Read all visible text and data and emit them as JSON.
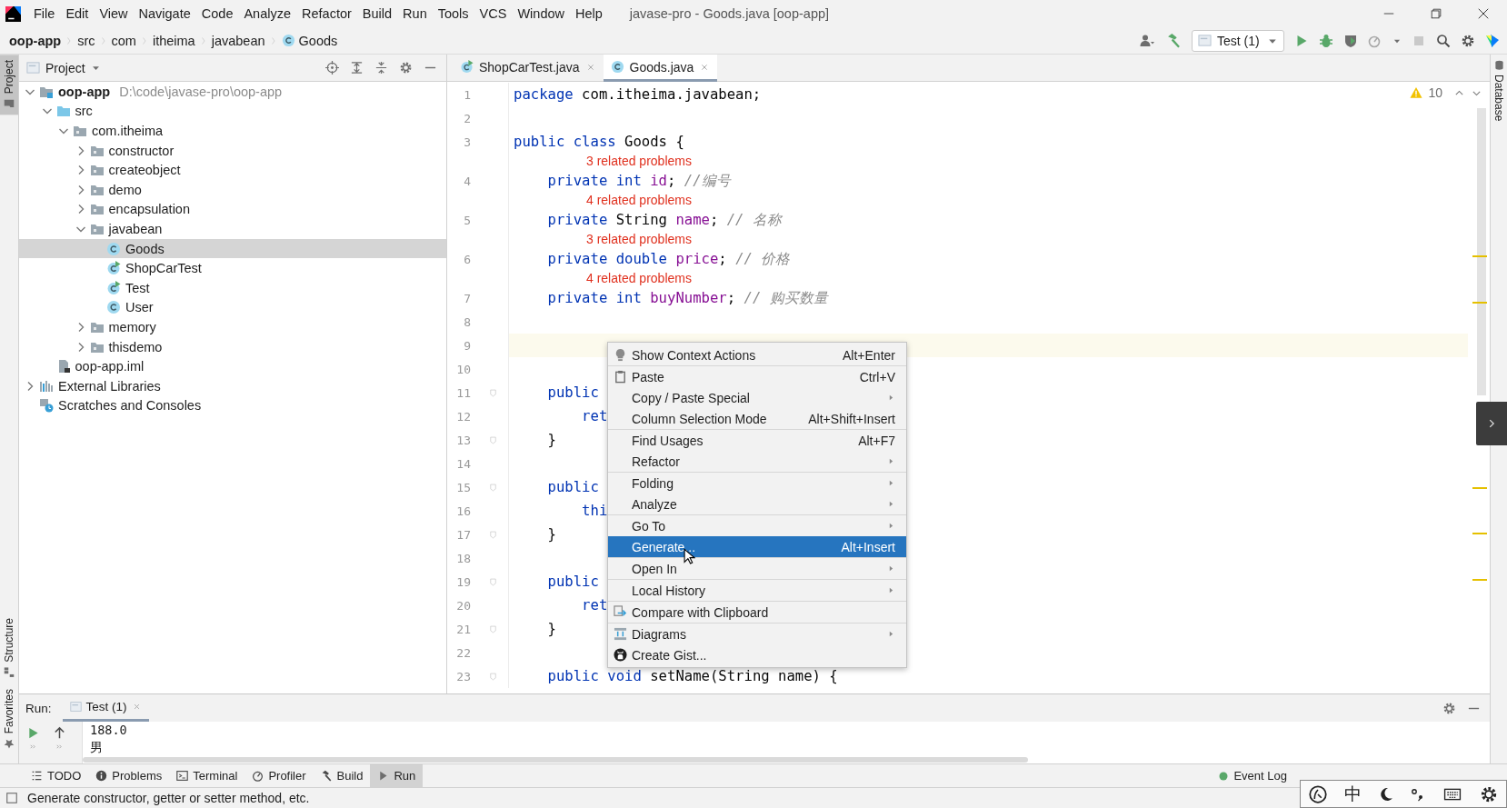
{
  "window": {
    "title": "javase-pro - Goods.java [oop-app]"
  },
  "menu": [
    "File",
    "Edit",
    "View",
    "Navigate",
    "Code",
    "Analyze",
    "Refactor",
    "Build",
    "Run",
    "Tools",
    "VCS",
    "Window",
    "Help"
  ],
  "breadcrumbs": [
    {
      "label": "oop-app",
      "kind": "module"
    },
    {
      "label": "src",
      "kind": "folder"
    },
    {
      "label": "com",
      "kind": "folder"
    },
    {
      "label": "itheima",
      "kind": "folder"
    },
    {
      "label": "javabean",
      "kind": "folder"
    },
    {
      "label": "Goods",
      "kind": "class"
    }
  ],
  "run_config": {
    "label": "Test (1)"
  },
  "left_strip": {
    "top": [
      {
        "label": "Project",
        "kind": "project",
        "selected": true
      }
    ],
    "bottom": [
      {
        "label": "Structure",
        "kind": "structure",
        "selected": false
      },
      {
        "label": "Favorites",
        "kind": "favorites",
        "selected": false
      }
    ]
  },
  "right_strip": [
    {
      "label": "Database",
      "kind": "database"
    }
  ],
  "project": {
    "title": "Project",
    "tree": [
      {
        "label": "oop-app",
        "kind": "module",
        "path": "D:\\code\\javase-pro\\oop-app",
        "expanded": true,
        "selected": false,
        "children": [
          {
            "label": "src",
            "kind": "source-folder",
            "expanded": true,
            "selected": false,
            "children": [
              {
                "label": "com.itheima",
                "kind": "package",
                "expanded": true,
                "selected": false,
                "children": [
                  {
                    "label": "constructor",
                    "kind": "package",
                    "expanded": false,
                    "selected": false
                  },
                  {
                    "label": "createobject",
                    "kind": "package",
                    "expanded": false,
                    "selected": false
                  },
                  {
                    "label": "demo",
                    "kind": "package",
                    "expanded": false,
                    "selected": false
                  },
                  {
                    "label": "encapsulation",
                    "kind": "package",
                    "expanded": false,
                    "selected": false
                  },
                  {
                    "label": "javabean",
                    "kind": "package",
                    "expanded": true,
                    "selected": false,
                    "children": [
                      {
                        "label": "Goods",
                        "kind": "class",
                        "selected": true
                      },
                      {
                        "label": "ShopCarTest",
                        "kind": "test-class",
                        "selected": false
                      },
                      {
                        "label": "Test",
                        "kind": "test-class",
                        "selected": false
                      },
                      {
                        "label": "User",
                        "kind": "class",
                        "selected": false
                      }
                    ]
                  },
                  {
                    "label": "memory",
                    "kind": "package",
                    "expanded": false,
                    "selected": false
                  },
                  {
                    "label": "thisdemo",
                    "kind": "package",
                    "expanded": false,
                    "selected": false
                  }
                ]
              }
            ]
          },
          {
            "label": "oop-app.iml",
            "kind": "module-file",
            "selected": false
          }
        ]
      },
      {
        "label": "External Libraries",
        "kind": "libraries",
        "expanded": false,
        "selected": false
      },
      {
        "label": "Scratches and Consoles",
        "kind": "scratches",
        "selected": false
      }
    ]
  },
  "editor_tabs": [
    {
      "label": "ShopCarTest.java",
      "kind": "test-class",
      "selected": false
    },
    {
      "label": "Goods.java",
      "kind": "class",
      "selected": true
    }
  ],
  "editor": {
    "warnings": "10",
    "lines": [
      {
        "kind": "code",
        "number": "1",
        "fold": false,
        "current": false,
        "tokens": [
          {
            "text": "package",
            "kind": "keyword"
          },
          {
            "text": " com.itheima.javabean;",
            "kind": "plain"
          }
        ]
      },
      {
        "kind": "code",
        "number": "2",
        "fold": false,
        "current": false
      },
      {
        "kind": "code",
        "number": "3",
        "fold": false,
        "current": false,
        "tokens": [
          {
            "text": "public class",
            "kind": "keyword"
          },
          {
            "text": " Goods {",
            "kind": "plain"
          }
        ]
      },
      {
        "kind": "inlay",
        "text": "3 related problems"
      },
      {
        "kind": "code",
        "number": "4",
        "fold": false,
        "current": false,
        "tokens": [
          {
            "text": "    private int ",
            "kind": "keyword"
          },
          {
            "text": "id",
            "kind": "field"
          },
          {
            "text": "; ",
            "kind": "plain"
          },
          {
            "text": "//编号",
            "kind": "comment"
          }
        ]
      },
      {
        "kind": "inlay",
        "text": "4 related problems"
      },
      {
        "kind": "code",
        "number": "5",
        "fold": false,
        "current": false,
        "tokens": [
          {
            "text": "    private",
            "kind": "keyword"
          },
          {
            "text": " String ",
            "kind": "plain"
          },
          {
            "text": "name",
            "kind": "field"
          },
          {
            "text": "; ",
            "kind": "plain"
          },
          {
            "text": "// 名称",
            "kind": "comment"
          }
        ]
      },
      {
        "kind": "inlay",
        "text": "3 related problems"
      },
      {
        "kind": "code",
        "number": "6",
        "fold": false,
        "current": false,
        "tokens": [
          {
            "text": "    private double ",
            "kind": "keyword"
          },
          {
            "text": "price",
            "kind": "field"
          },
          {
            "text": "; ",
            "kind": "plain"
          },
          {
            "text": "// 价格",
            "kind": "comment"
          }
        ]
      },
      {
        "kind": "inlay",
        "text": "4 related problems"
      },
      {
        "kind": "code",
        "number": "7",
        "fold": false,
        "current": false,
        "tokens": [
          {
            "text": "    private int ",
            "kind": "keyword"
          },
          {
            "text": "buyNumber",
            "kind": "field"
          },
          {
            "text": "; ",
            "kind": "plain"
          },
          {
            "text": "// 购买数量",
            "kind": "comment"
          }
        ]
      },
      {
        "kind": "code",
        "number": "8",
        "fold": false,
        "current": false
      },
      {
        "kind": "code",
        "number": "9",
        "fold": false,
        "current": true
      },
      {
        "kind": "code",
        "number": "10",
        "fold": false,
        "current": false
      },
      {
        "kind": "code",
        "number": "11",
        "fold": true,
        "current": false,
        "tokens": [
          {
            "text": "    public",
            "kind": "keyword"
          }
        ]
      },
      {
        "kind": "code",
        "number": "12",
        "fold": false,
        "current": false,
        "tokens": [
          {
            "text": "        ret",
            "kind": "keyword"
          }
        ]
      },
      {
        "kind": "code",
        "number": "13",
        "fold": true,
        "current": false,
        "tokens": [
          {
            "text": "    }",
            "kind": "plain"
          }
        ]
      },
      {
        "kind": "code",
        "number": "14",
        "fold": false,
        "current": false
      },
      {
        "kind": "code",
        "number": "15",
        "fold": true,
        "current": false,
        "tokens": [
          {
            "text": "    public",
            "kind": "keyword"
          }
        ]
      },
      {
        "kind": "code",
        "number": "16",
        "fold": false,
        "current": false,
        "tokens": [
          {
            "text": "        thi",
            "kind": "keyword"
          }
        ]
      },
      {
        "kind": "code",
        "number": "17",
        "fold": true,
        "current": false,
        "tokens": [
          {
            "text": "    }",
            "kind": "plain"
          }
        ]
      },
      {
        "kind": "code",
        "number": "18",
        "fold": false,
        "current": false
      },
      {
        "kind": "code",
        "number": "19",
        "fold": true,
        "current": false,
        "tokens": [
          {
            "text": "    public",
            "kind": "keyword"
          }
        ]
      },
      {
        "kind": "code",
        "number": "20",
        "fold": false,
        "current": false,
        "tokens": [
          {
            "text": "        ret",
            "kind": "keyword"
          }
        ]
      },
      {
        "kind": "code",
        "number": "21",
        "fold": true,
        "current": false,
        "tokens": [
          {
            "text": "    }",
            "kind": "plain"
          }
        ]
      },
      {
        "kind": "code",
        "number": "22",
        "fold": false,
        "current": false
      },
      {
        "kind": "code",
        "number": "23",
        "fold": true,
        "current": false,
        "tokens": [
          {
            "text": "    public void",
            "kind": "keyword"
          },
          {
            "text": " setName(String name) {",
            "kind": "plain"
          }
        ]
      }
    ]
  },
  "context_menu": {
    "groups": [
      [
        {
          "label": "Show Context Actions",
          "shortcut": "Alt+Enter",
          "kind": "context-actions",
          "submenu": false,
          "selected": false
        }
      ],
      [
        {
          "label": "Paste",
          "shortcut": "Ctrl+V",
          "kind": "paste",
          "submenu": false,
          "selected": false
        },
        {
          "label": "Copy / Paste Special",
          "kind": "plain",
          "submenu": true,
          "selected": false
        },
        {
          "label": "Column Selection Mode",
          "shortcut": "Alt+Shift+Insert",
          "kind": "plain",
          "submenu": false,
          "selected": false
        }
      ],
      [
        {
          "label": "Find Usages",
          "shortcut": "Alt+F7",
          "kind": "plain",
          "submenu": false,
          "selected": false
        },
        {
          "label": "Refactor",
          "kind": "plain",
          "submenu": true,
          "selected": false
        }
      ],
      [
        {
          "label": "Folding",
          "kind": "plain",
          "submenu": true,
          "selected": false
        },
        {
          "label": "Analyze",
          "kind": "plain",
          "submenu": true,
          "selected": false
        }
      ],
      [
        {
          "label": "Go To",
          "kind": "plain",
          "submenu": true,
          "selected": false
        },
        {
          "label": "Generate...",
          "shortcut": "Alt+Insert",
          "kind": "plain",
          "submenu": false,
          "selected": true
        }
      ],
      [
        {
          "label": "Open In",
          "kind": "plain",
          "submenu": true,
          "selected": false
        }
      ],
      [
        {
          "label": "Local History",
          "kind": "plain",
          "submenu": true,
          "selected": false
        }
      ],
      [
        {
          "label": "Compare with Clipboard",
          "kind": "compare",
          "submenu": false,
          "selected": false
        }
      ],
      [
        {
          "label": "Diagrams",
          "kind": "diagrams",
          "submenu": true,
          "selected": false
        },
        {
          "label": "Create Gist...",
          "kind": "gist",
          "submenu": false,
          "selected": false
        }
      ]
    ]
  },
  "run_panel": {
    "label": "Run:",
    "tabs": [
      {
        "label": "Test (1)",
        "selected": true
      }
    ],
    "output": [
      "188.0",
      "男"
    ]
  },
  "tool_windows": [
    {
      "label": "TODO",
      "kind": "todo",
      "selected": false
    },
    {
      "label": "Problems",
      "kind": "problems",
      "selected": false
    },
    {
      "label": "Terminal",
      "kind": "terminal",
      "selected": false
    },
    {
      "label": "Profiler",
      "kind": "profiler",
      "selected": false
    },
    {
      "label": "Build",
      "kind": "build",
      "selected": false
    },
    {
      "label": "Run",
      "kind": "run",
      "selected": true
    }
  ],
  "event_log": {
    "label": "Event Log"
  },
  "ime_toolbar": {
    "mode": "中"
  },
  "status": "Generate constructor, getter or setter method, etc."
}
